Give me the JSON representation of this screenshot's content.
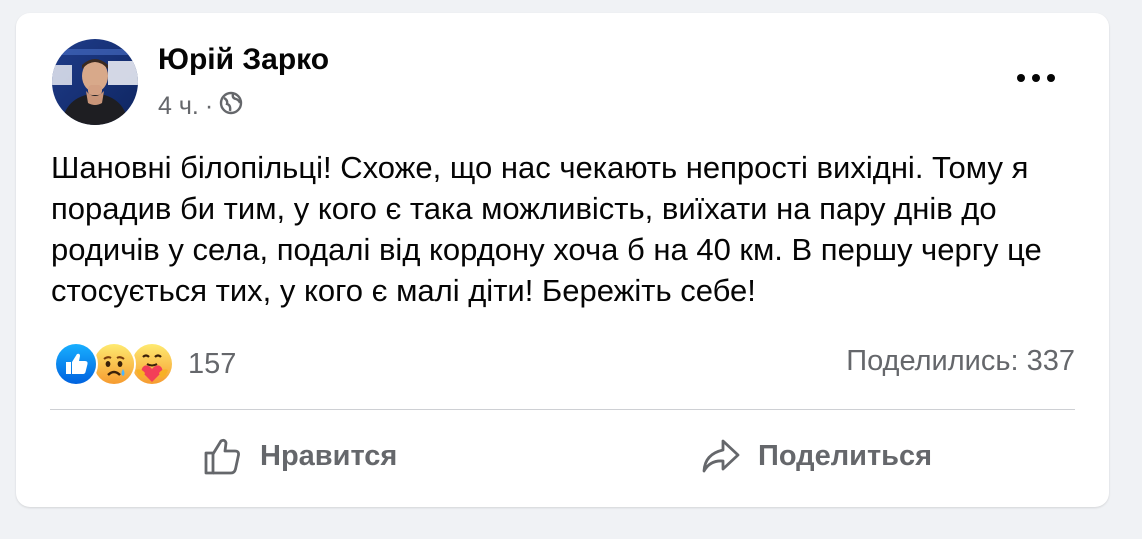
{
  "post": {
    "author": "Юрій Зарко",
    "time": "4 ч.",
    "separator": "·",
    "privacy_icon": "globe-icon",
    "more_icon": "more-options-icon",
    "text": "Шановні білопільці! Схоже, що нас чекають непрості вихідні. Тому я порадив би тим, у кого є така можливість, виїхати на пару днів до родичів у села, подалі від кордону хоча б на 40 км. В першу чергу це стосується тих, у кого є малі діти! Бережіть себе!",
    "reactions": {
      "icons": [
        "like-reaction-icon",
        "sad-reaction-icon",
        "care-reaction-icon"
      ],
      "count": "157"
    },
    "shares": "Поделились: 337"
  },
  "actions": {
    "like_label": "Нравится",
    "share_label": "Поделиться"
  },
  "colors": {
    "background": "#f0f2f5",
    "card": "#ffffff",
    "text": "#050505",
    "secondary_text": "#65676b",
    "like_blue": "#1877f2",
    "divider": "#ced0d4"
  }
}
